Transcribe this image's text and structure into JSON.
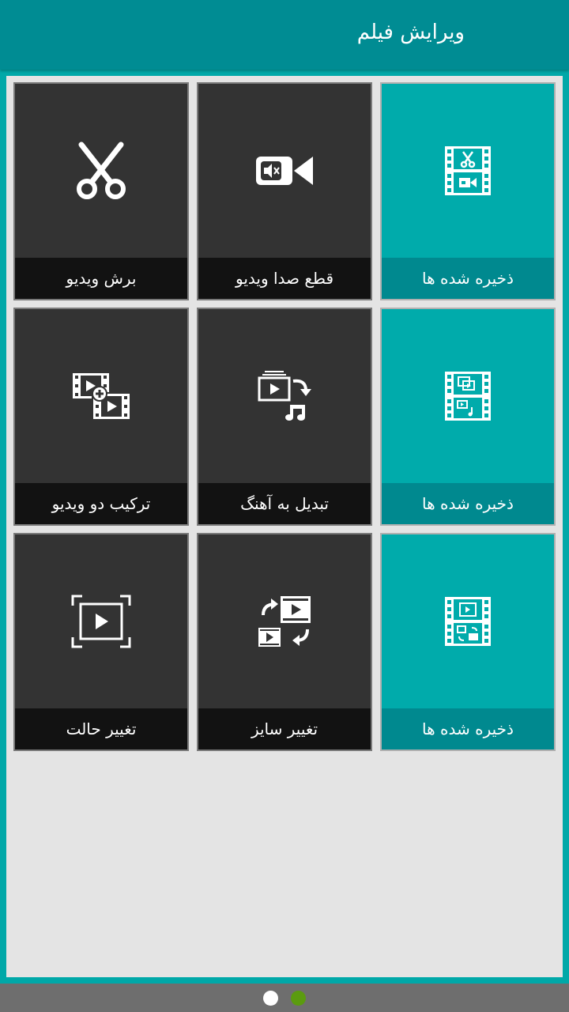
{
  "header": {
    "title": "ویرایش فیلم"
  },
  "tiles": [
    {
      "label": "ذخیره شده ها",
      "icon": "saved-cut-film-icon"
    },
    {
      "label": "قطع صدا ویدیو",
      "icon": "muted-video-camera-icon"
    },
    {
      "label": "برش ویدیو",
      "icon": "scissors-icon"
    },
    {
      "label": "ذخیره شده ها",
      "icon": "saved-audio-film-icon"
    },
    {
      "label": "تبدیل به آهنگ",
      "icon": "video-to-music-icon"
    },
    {
      "label": "ترکیب دو ویدیو",
      "icon": "merge-videos-icon"
    },
    {
      "label": "ذخیره شده ها",
      "icon": "saved-resize-film-icon"
    },
    {
      "label": "تغییر سایز",
      "icon": "resize-video-icon"
    },
    {
      "label": "تغییر حالت",
      "icon": "change-mode-icon"
    }
  ],
  "pager": {
    "pages": 2,
    "active": 2
  },
  "colors": {
    "header": "#008c93",
    "teal_tile": "#00abab",
    "dark_tile": "#333333",
    "pager_inactive": "#ffffff",
    "pager_active": "#5b9b0f"
  }
}
